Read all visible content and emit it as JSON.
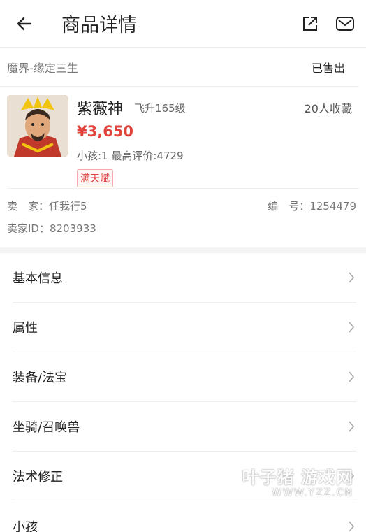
{
  "header": {
    "title": "商品详情",
    "back_icon": "arrow-left-icon",
    "share_icon": "share-external-icon",
    "mail_icon": "mail-icon"
  },
  "listing": {
    "server": "魔界-缘定三生",
    "status": "已售出",
    "name": "紫薇神",
    "level": "飞升165级",
    "favorites": "20人收藏",
    "price": "¥3,650",
    "meta": "小孩:1 最高评价:4729",
    "tag": "满天赋"
  },
  "seller": {
    "seller_name": "卖　家：任我行5",
    "serial": "编　号：1254479",
    "seller_id": "卖家ID：8203933"
  },
  "menu": [
    {
      "label": "基本信息"
    },
    {
      "label": "属性"
    },
    {
      "label": "装备/法宝"
    },
    {
      "label": "坐骑/召唤兽"
    },
    {
      "label": "法术修正"
    },
    {
      "label": "小孩"
    }
  ],
  "watermark": {
    "line1": "叶子猪 游戏网",
    "line2": "WWW.YZZ.CN"
  },
  "colors": {
    "price": "#e0443d",
    "tag_border": "#f4a7a4"
  }
}
